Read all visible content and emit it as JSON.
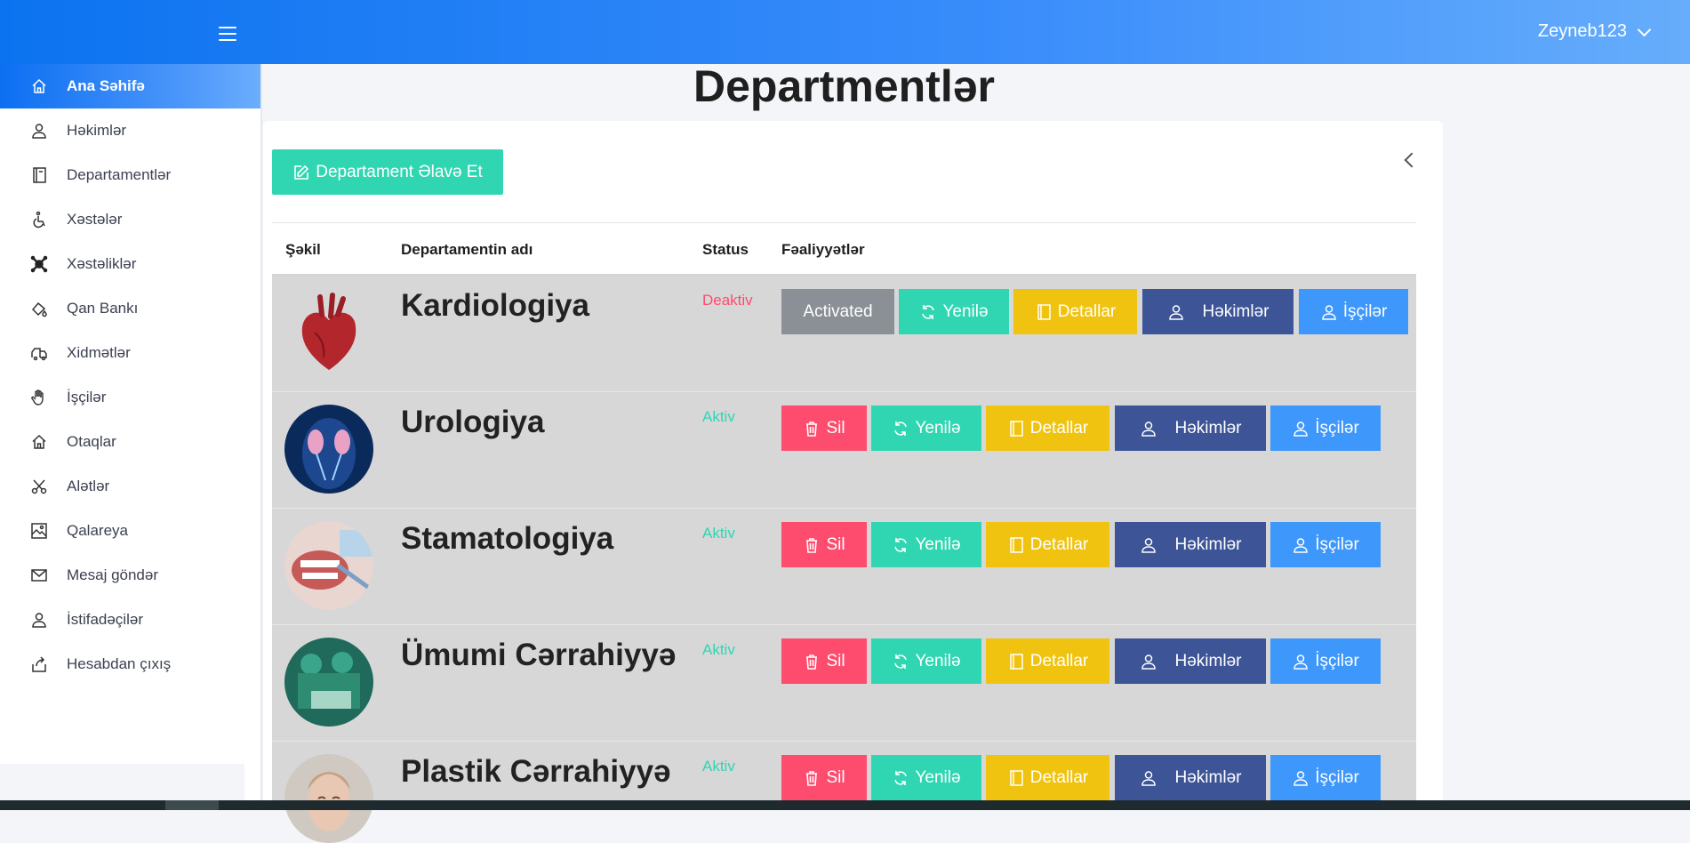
{
  "header": {
    "username": "Zeyneb123"
  },
  "sidebar": {
    "items": [
      {
        "label": "Ana Səhifə",
        "icon": "home-icon",
        "active": true
      },
      {
        "label": "Həkimlər",
        "icon": "user-icon"
      },
      {
        "label": "Departamentlər",
        "icon": "book-icon"
      },
      {
        "label": "Xəstələr",
        "icon": "wheelchair-icon"
      },
      {
        "label": "Xəstəliklər",
        "icon": "virus-icon"
      },
      {
        "label": "Qan Bankı",
        "icon": "blood-drop-icon"
      },
      {
        "label": "Xidmətlər",
        "icon": "truck-icon"
      },
      {
        "label": "İşçilər",
        "icon": "hand-icon"
      },
      {
        "label": "Otaqlar",
        "icon": "house-icon"
      },
      {
        "label": "Alətlər",
        "icon": "scissors-icon"
      },
      {
        "label": "Qalareya",
        "icon": "gallery-icon"
      },
      {
        "label": "Mesaj göndər",
        "icon": "envelope-icon"
      },
      {
        "label": "İstifadəçilər",
        "icon": "users-icon"
      },
      {
        "label": "Hesabdan çıxış",
        "icon": "logout-icon"
      }
    ]
  },
  "main": {
    "title": "Departmentlər",
    "add_button": "Departament Əlavə Et",
    "columns": [
      "Şəkil",
      "Departamentin adı",
      "Status",
      "Fəaliyyətlər"
    ],
    "rows": [
      {
        "name": "Kardiologiya",
        "status": "Deaktiv",
        "toggle_label": "Activated"
      },
      {
        "name": "Urologiya",
        "status": "Aktiv",
        "toggle_label": "Sil"
      },
      {
        "name": "Stamatologiya",
        "status": "Aktiv",
        "toggle_label": "Sil"
      },
      {
        "name": "Ümumi Cərrahiyyə",
        "status": "Aktiv",
        "toggle_label": "Sil"
      },
      {
        "name": "Plastik Cərrahiyyə",
        "status": "Aktiv",
        "toggle_label": "Sil"
      }
    ],
    "actions": {
      "update": "Yenilə",
      "details": "Detallar",
      "doctors": "Həkimlər",
      "workers": "İşçilər"
    }
  },
  "colors": {
    "primary": "#0c73f0",
    "teal": "#30d6b2",
    "red": "#fe4c6e",
    "yellow": "#f0c311",
    "navy": "#3d5597",
    "blue": "#3e97fb",
    "gray": "#8a9096"
  }
}
